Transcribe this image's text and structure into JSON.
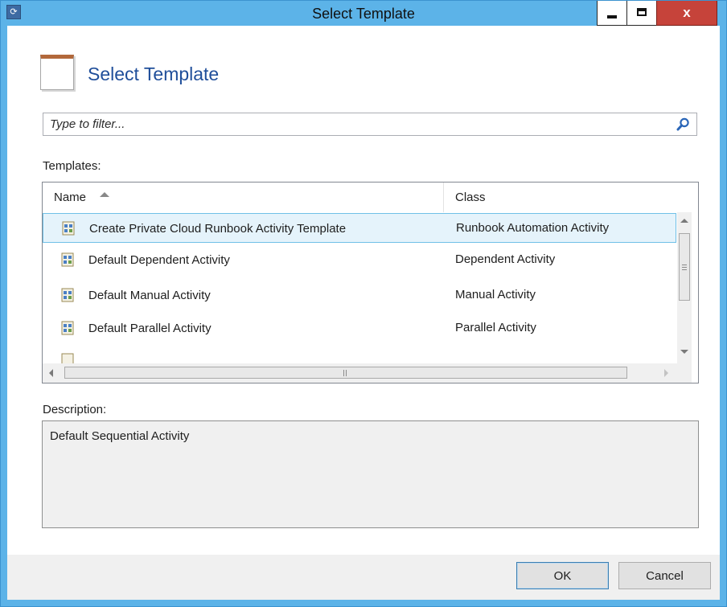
{
  "window": {
    "title": "Select Template",
    "close_label": "x"
  },
  "header": {
    "title": "Select Template"
  },
  "filter": {
    "placeholder": "Type to filter...",
    "value": ""
  },
  "templates": {
    "label": "Templates:",
    "columns": {
      "name": "Name",
      "class": "Class"
    },
    "sort_column": "Name",
    "sort_direction": "ascending",
    "rows": [
      {
        "name": "Create Private Cloud Runbook Activity Template",
        "class": "Runbook Automation Activity",
        "selected": true
      },
      {
        "name": "Default Dependent Activity",
        "class": "Dependent Activity",
        "selected": false
      },
      {
        "name": "Default Manual Activity",
        "class": "Manual Activity",
        "selected": false
      },
      {
        "name": "Default Parallel Activity",
        "class": "Parallel Activity",
        "selected": false
      }
    ]
  },
  "description": {
    "label": "Description:",
    "text": "Default Sequential Activity"
  },
  "buttons": {
    "ok": "OK",
    "cancel": "Cancel"
  },
  "icons": {
    "app": "app-icon",
    "header": "template-icon",
    "search": "search-icon",
    "row": "activity-template-icon"
  },
  "colors": {
    "window_frame": "#5cb3e8",
    "header_title": "#1f4e9a",
    "selection_bg": "#e5f3fb",
    "selection_border": "#70c0e7",
    "close_button": "#c6433a"
  }
}
